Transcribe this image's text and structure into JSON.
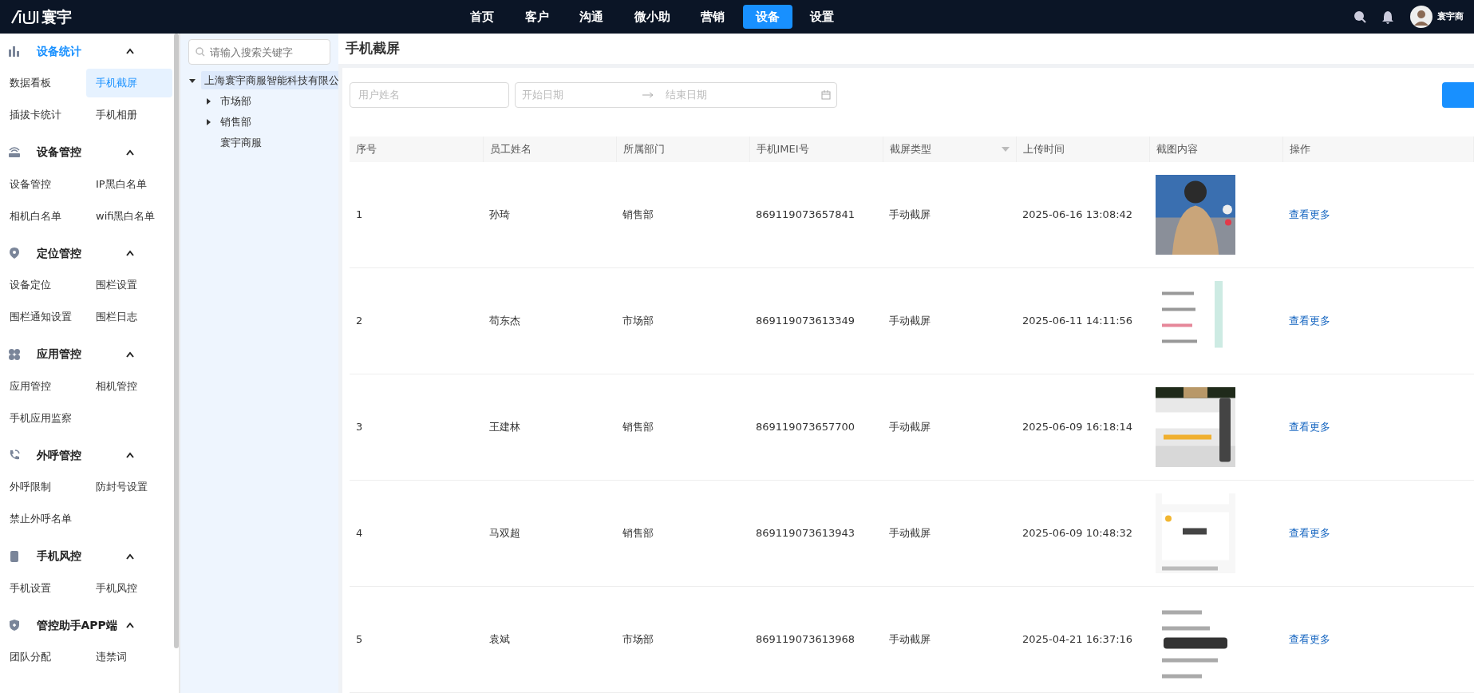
{
  "top_nav": {
    "brand": "寰宇",
    "items": [
      {
        "label": "首页",
        "selected": false
      },
      {
        "label": "客户",
        "selected": false
      },
      {
        "label": "沟通",
        "selected": false
      },
      {
        "label": "微小助",
        "selected": false
      },
      {
        "label": "营销",
        "selected": false
      },
      {
        "label": "设备",
        "selected": true
      },
      {
        "label": "设置",
        "selected": false
      }
    ],
    "user_name": "寰宇商"
  },
  "sidebar": {
    "groups": [
      {
        "title": "设备统计",
        "expanded": true,
        "selected": true,
        "items": [
          {
            "label": "数据看板",
            "selected": false
          },
          {
            "label": "手机截屏",
            "selected": true
          },
          {
            "label": "插拔卡统计",
            "selected": false
          },
          {
            "label": "手机相册",
            "selected": false
          }
        ]
      },
      {
        "title": "设备管控",
        "expanded": true,
        "selected": false,
        "items": [
          {
            "label": "设备管控",
            "selected": false
          },
          {
            "label": "IP黑白名单",
            "selected": false
          },
          {
            "label": "相机白名单",
            "selected": false
          },
          {
            "label": "wifi黑白名单",
            "selected": false
          }
        ]
      },
      {
        "title": "定位管控",
        "expanded": true,
        "selected": false,
        "items": [
          {
            "label": "设备定位",
            "selected": false
          },
          {
            "label": "围栏设置",
            "selected": false
          },
          {
            "label": "围栏通知设置",
            "selected": false
          },
          {
            "label": "围栏日志",
            "selected": false
          }
        ]
      },
      {
        "title": "应用管控",
        "expanded": true,
        "selected": false,
        "items": [
          {
            "label": "应用管控",
            "selected": false
          },
          {
            "label": "相机管控",
            "selected": false
          },
          {
            "label": "手机应用监察",
            "selected": false
          }
        ]
      },
      {
        "title": "外呼管控",
        "expanded": true,
        "selected": false,
        "items": [
          {
            "label": "外呼限制",
            "selected": false
          },
          {
            "label": "防封号设置",
            "selected": false
          },
          {
            "label": "禁止外呼名单",
            "selected": false
          }
        ]
      },
      {
        "title": "手机风控",
        "expanded": true,
        "selected": false,
        "items": [
          {
            "label": "手机设置",
            "selected": false
          },
          {
            "label": "手机风控",
            "selected": false
          }
        ]
      },
      {
        "title": "管控助手APP端",
        "expanded": true,
        "selected": false,
        "items": [
          {
            "label": "团队分配",
            "selected": false
          },
          {
            "label": "违禁词",
            "selected": false
          }
        ]
      }
    ]
  },
  "tree": {
    "search": {
      "placeholder": "请输入搜索关键字"
    },
    "nodes": [
      {
        "label": "上海寰宇商服智能科技有限公",
        "selected": true,
        "expanded": true,
        "children": [
          {
            "label": "市场部",
            "selected": false,
            "expanded": false
          },
          {
            "label": "销售部",
            "selected": false,
            "expanded": false
          },
          {
            "label": "寰宇商服",
            "selected": false
          }
        ]
      }
    ]
  },
  "page": {
    "title": "手机截屏",
    "filters": {
      "user": {
        "placeholder": "用户姓名"
      },
      "start_date": {
        "placeholder": "开始日期"
      },
      "end_date": {
        "placeholder": "结束日期"
      }
    },
    "table": {
      "columns": [
        {
          "label": "序号",
          "filterable": false
        },
        {
          "label": "员工姓名",
          "filterable": false
        },
        {
          "label": "所属部门",
          "filterable": false
        },
        {
          "label": "手机IMEI号",
          "filterable": false
        },
        {
          "label": "截屏类型",
          "filterable": true
        },
        {
          "label": "上传时间",
          "filterable": false
        },
        {
          "label": "截图内容",
          "filterable": false
        },
        {
          "label": "操作",
          "filterable": false
        }
      ],
      "rows": [
        {
          "index": "1",
          "name": "孙琦",
          "department": "销售部",
          "imei": "869119073657841",
          "type": "手动截屏",
          "time": "2025-06-16 13:08:42",
          "action": "查看更多"
        },
        {
          "index": "2",
          "name": "苟东杰",
          "department": "市场部",
          "imei": "869119073613349",
          "type": "手动截屏",
          "time": "2025-06-11 14:11:56",
          "action": "查看更多"
        },
        {
          "index": "3",
          "name": "王建林",
          "department": "销售部",
          "imei": "869119073657700",
          "type": "手动截屏",
          "time": "2025-06-09 16:18:14",
          "action": "查看更多"
        },
        {
          "index": "4",
          "name": "马双超",
          "department": "销售部",
          "imei": "869119073613943",
          "type": "手动截屏",
          "time": "2025-06-09 10:48:32",
          "action": "查看更多"
        },
        {
          "index": "5",
          "name": "袁斌",
          "department": "市场部",
          "imei": "869119073613968",
          "type": "手动截屏",
          "time": "2025-04-21 16:37:16",
          "action": "查看更多"
        }
      ]
    }
  }
}
